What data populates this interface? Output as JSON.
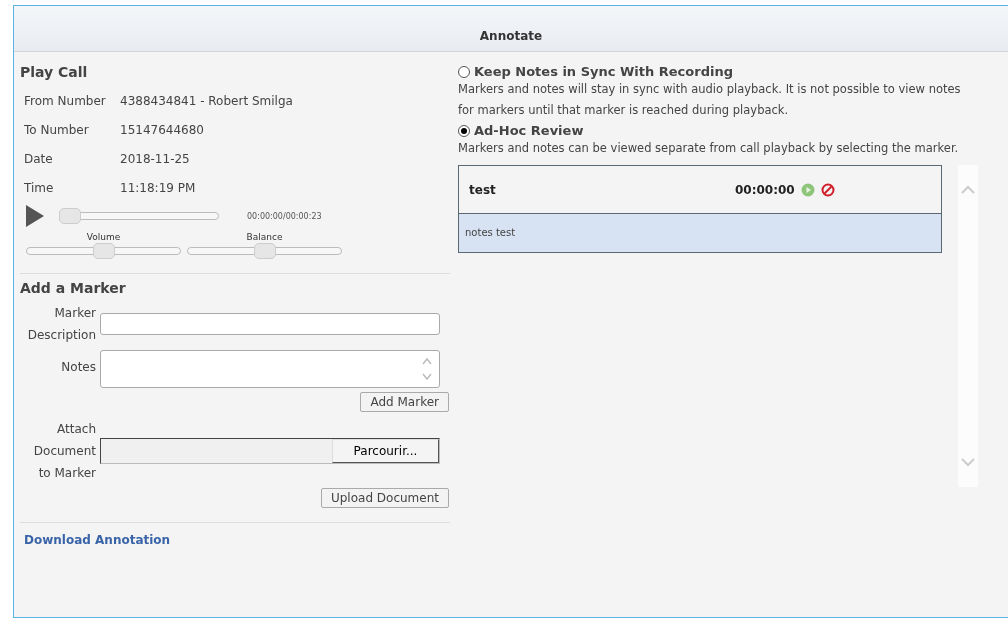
{
  "window": {
    "title": "Annotate"
  },
  "play_call": {
    "heading": "Play Call",
    "fields": [
      {
        "label": "From Number",
        "value": "4388434841 - Robert Smilga"
      },
      {
        "label": "To Number",
        "value": "15147644680"
      },
      {
        "label": "Date",
        "value": "2018-11-25"
      },
      {
        "label": "Time",
        "value": "11:18:19 PM"
      }
    ],
    "position": {
      "level": 0,
      "reading": "00:00:00/00:00:23"
    },
    "volume": {
      "label": "Volume",
      "level": 0.5
    },
    "balance": {
      "label": "Balance",
      "level": 0.5
    }
  },
  "add_marker": {
    "heading": "Add a Marker",
    "description_label": "Marker Description",
    "notes_label": "Notes",
    "add_button": "Add Marker",
    "attach_label": "Attach Document to Marker",
    "browse_button": "Parcourir...",
    "upload_button": "Upload Document"
  },
  "download_link": "Download Annotation",
  "modes": [
    {
      "label": "Keep Notes in Sync With Recording",
      "selected": false,
      "description": "Markers and notes will stay in sync with audio playback. It is not possible to view notes for markers until that marker is reached during playback."
    },
    {
      "label": "Ad-Hoc Review",
      "selected": true,
      "description": "Markers and notes can be viewed separate from call playback by selecting the marker."
    }
  ],
  "markers": [
    {
      "title": "test",
      "time": "00:00:00",
      "notes": "notes test"
    }
  ]
}
